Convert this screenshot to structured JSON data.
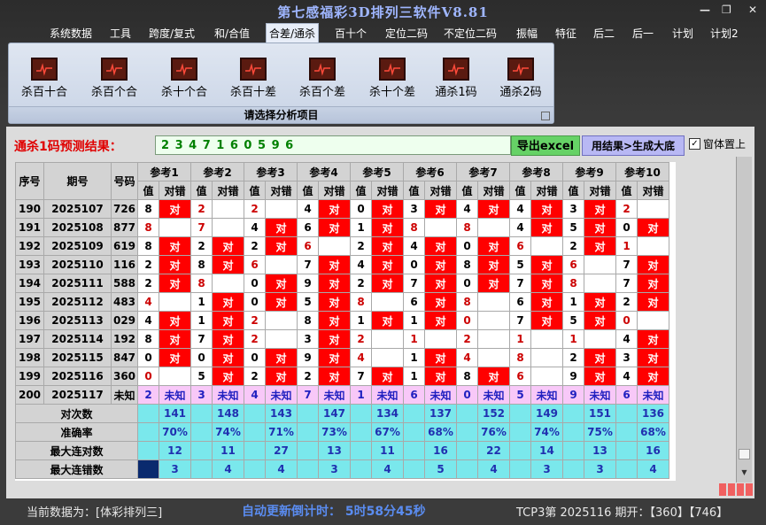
{
  "window": {
    "title": "第七感福彩3D排列三软件V8.81"
  },
  "menu": [
    "系统数据",
    "工具",
    "跨度/复式",
    "和/合值",
    "合差/通杀",
    "百十个",
    "定位二码",
    "不定位二码",
    "振幅",
    "特征",
    "后二",
    "后一",
    "计划",
    "计划2"
  ],
  "menu_active_index": 4,
  "ribbon": {
    "tools": [
      "杀百十合",
      "杀百个合",
      "杀十个合",
      "杀百十差",
      "杀百个差",
      "杀十个差",
      "通杀1码",
      "通杀2码"
    ],
    "caption": "请选择分析项目"
  },
  "prediction": {
    "label": "通杀1码预测结果：",
    "result": "2 3 4 7 1 6 0 5 9 6",
    "export_button": "导出excel",
    "generate_button": "用结果>生成大底",
    "always_on_top_label": "窗体置上",
    "always_on_top_checked": true
  },
  "table": {
    "col_headers": {
      "seq": "序号",
      "issue": "期号",
      "number": "号码",
      "value": "值",
      "result": "对错"
    },
    "refs": [
      "参考1",
      "参考2",
      "参考3",
      "参考4",
      "参考5",
      "参考6",
      "参考7",
      "参考8",
      "参考9",
      "参考10"
    ],
    "hit_text": "对",
    "rows": [
      {
        "seq": "190",
        "issue": "2025107",
        "number": "726",
        "vals": [
          "8",
          "2",
          "2",
          "4",
          "0",
          "3",
          "4",
          "4",
          "3",
          "2"
        ],
        "hit": [
          true,
          false,
          false,
          true,
          true,
          true,
          true,
          true,
          true,
          false
        ],
        "red": [
          false,
          true,
          true,
          false,
          false,
          false,
          false,
          false,
          false,
          true
        ]
      },
      {
        "seq": "191",
        "issue": "2025108",
        "number": "877",
        "vals": [
          "8",
          "7",
          "4",
          "6",
          "1",
          "8",
          "8",
          "4",
          "5",
          "0"
        ],
        "hit": [
          false,
          false,
          true,
          true,
          true,
          false,
          false,
          true,
          true,
          true
        ],
        "red": [
          true,
          true,
          false,
          false,
          false,
          true,
          true,
          false,
          false,
          false
        ]
      },
      {
        "seq": "192",
        "issue": "2025109",
        "number": "619",
        "vals": [
          "8",
          "2",
          "2",
          "6",
          "2",
          "4",
          "0",
          "6",
          "2",
          "1"
        ],
        "hit": [
          true,
          true,
          true,
          false,
          true,
          true,
          true,
          false,
          true,
          false
        ],
        "red": [
          false,
          false,
          false,
          true,
          false,
          false,
          false,
          true,
          false,
          true
        ]
      },
      {
        "seq": "193",
        "issue": "2025110",
        "number": "116",
        "vals": [
          "2",
          "8",
          "6",
          "7",
          "4",
          "0",
          "8",
          "5",
          "6",
          "7"
        ],
        "hit": [
          true,
          true,
          false,
          true,
          true,
          true,
          true,
          true,
          false,
          true
        ],
        "red": [
          false,
          false,
          true,
          false,
          false,
          false,
          false,
          false,
          true,
          false
        ]
      },
      {
        "seq": "194",
        "issue": "2025111",
        "number": "588",
        "vals": [
          "2",
          "8",
          "0",
          "9",
          "2",
          "7",
          "0",
          "7",
          "8",
          "7"
        ],
        "hit": [
          true,
          false,
          true,
          true,
          true,
          true,
          true,
          true,
          false,
          true
        ],
        "red": [
          false,
          true,
          false,
          false,
          false,
          false,
          false,
          false,
          true,
          false
        ]
      },
      {
        "seq": "195",
        "issue": "2025112",
        "number": "483",
        "vals": [
          "4",
          "1",
          "0",
          "5",
          "8",
          "6",
          "8",
          "6",
          "1",
          "2"
        ],
        "hit": [
          false,
          true,
          true,
          true,
          false,
          true,
          false,
          true,
          true,
          true
        ],
        "red": [
          true,
          false,
          false,
          false,
          true,
          false,
          true,
          false,
          false,
          false
        ]
      },
      {
        "seq": "196",
        "issue": "2025113",
        "number": "029",
        "vals": [
          "4",
          "1",
          "2",
          "8",
          "1",
          "1",
          "0",
          "7",
          "5",
          "0"
        ],
        "hit": [
          true,
          true,
          false,
          true,
          true,
          true,
          false,
          true,
          true,
          false
        ],
        "red": [
          false,
          false,
          true,
          false,
          false,
          false,
          true,
          false,
          false,
          true
        ]
      },
      {
        "seq": "197",
        "issue": "2025114",
        "number": "192",
        "vals": [
          "8",
          "7",
          "2",
          "3",
          "2",
          "1",
          "2",
          "1",
          "1",
          "4"
        ],
        "hit": [
          true,
          true,
          false,
          true,
          false,
          false,
          false,
          false,
          false,
          true
        ],
        "red": [
          false,
          false,
          true,
          false,
          true,
          true,
          true,
          true,
          true,
          false
        ]
      },
      {
        "seq": "198",
        "issue": "2025115",
        "number": "847",
        "vals": [
          "0",
          "0",
          "0",
          "9",
          "4",
          "1",
          "4",
          "8",
          "2",
          "3"
        ],
        "hit": [
          true,
          true,
          true,
          true,
          false,
          true,
          false,
          false,
          true,
          true
        ],
        "red": [
          false,
          false,
          false,
          false,
          true,
          false,
          true,
          true,
          false,
          false
        ]
      },
      {
        "seq": "199",
        "issue": "2025116",
        "number": "360",
        "vals": [
          "0",
          "5",
          "2",
          "2",
          "7",
          "1",
          "8",
          "6",
          "9",
          "4"
        ],
        "hit": [
          false,
          true,
          true,
          true,
          true,
          true,
          true,
          false,
          true,
          true
        ],
        "red": [
          true,
          false,
          false,
          false,
          false,
          false,
          false,
          true,
          false,
          false
        ]
      },
      {
        "seq": "200",
        "issue": "2025117",
        "number": "未知",
        "vals": [
          "2",
          "3",
          "4",
          "7",
          "1",
          "6",
          "0",
          "5",
          "9",
          "6"
        ],
        "pending": "未知"
      }
    ],
    "stats": [
      {
        "label": "对次数",
        "values": [
          "141",
          "148",
          "143",
          "147",
          "134",
          "137",
          "152",
          "149",
          "151",
          "136"
        ]
      },
      {
        "label": "准确率",
        "values": [
          "70%",
          "74%",
          "71%",
          "73%",
          "67%",
          "68%",
          "76%",
          "74%",
          "75%",
          "68%"
        ]
      },
      {
        "label": "最大连对数",
        "values": [
          "12",
          "11",
          "27",
          "13",
          "11",
          "16",
          "22",
          "14",
          "13",
          "16"
        ]
      },
      {
        "label": "最大连错数",
        "values": [
          "3",
          "4",
          "4",
          "3",
          "4",
          "5",
          "4",
          "3",
          "3",
          "4"
        ]
      }
    ]
  },
  "status": {
    "data_source": "当前数据为：[体彩排列三]",
    "timer": "自动更新倒计时：  5时58分45秒",
    "draw_info": "TCP3第 2025116 期开：【360】【746】"
  },
  "colors": {
    "hit": "#ff0000",
    "stat": "#7ae8ec",
    "pending": "#f8c8f8",
    "title": "#9fb6ff"
  }
}
